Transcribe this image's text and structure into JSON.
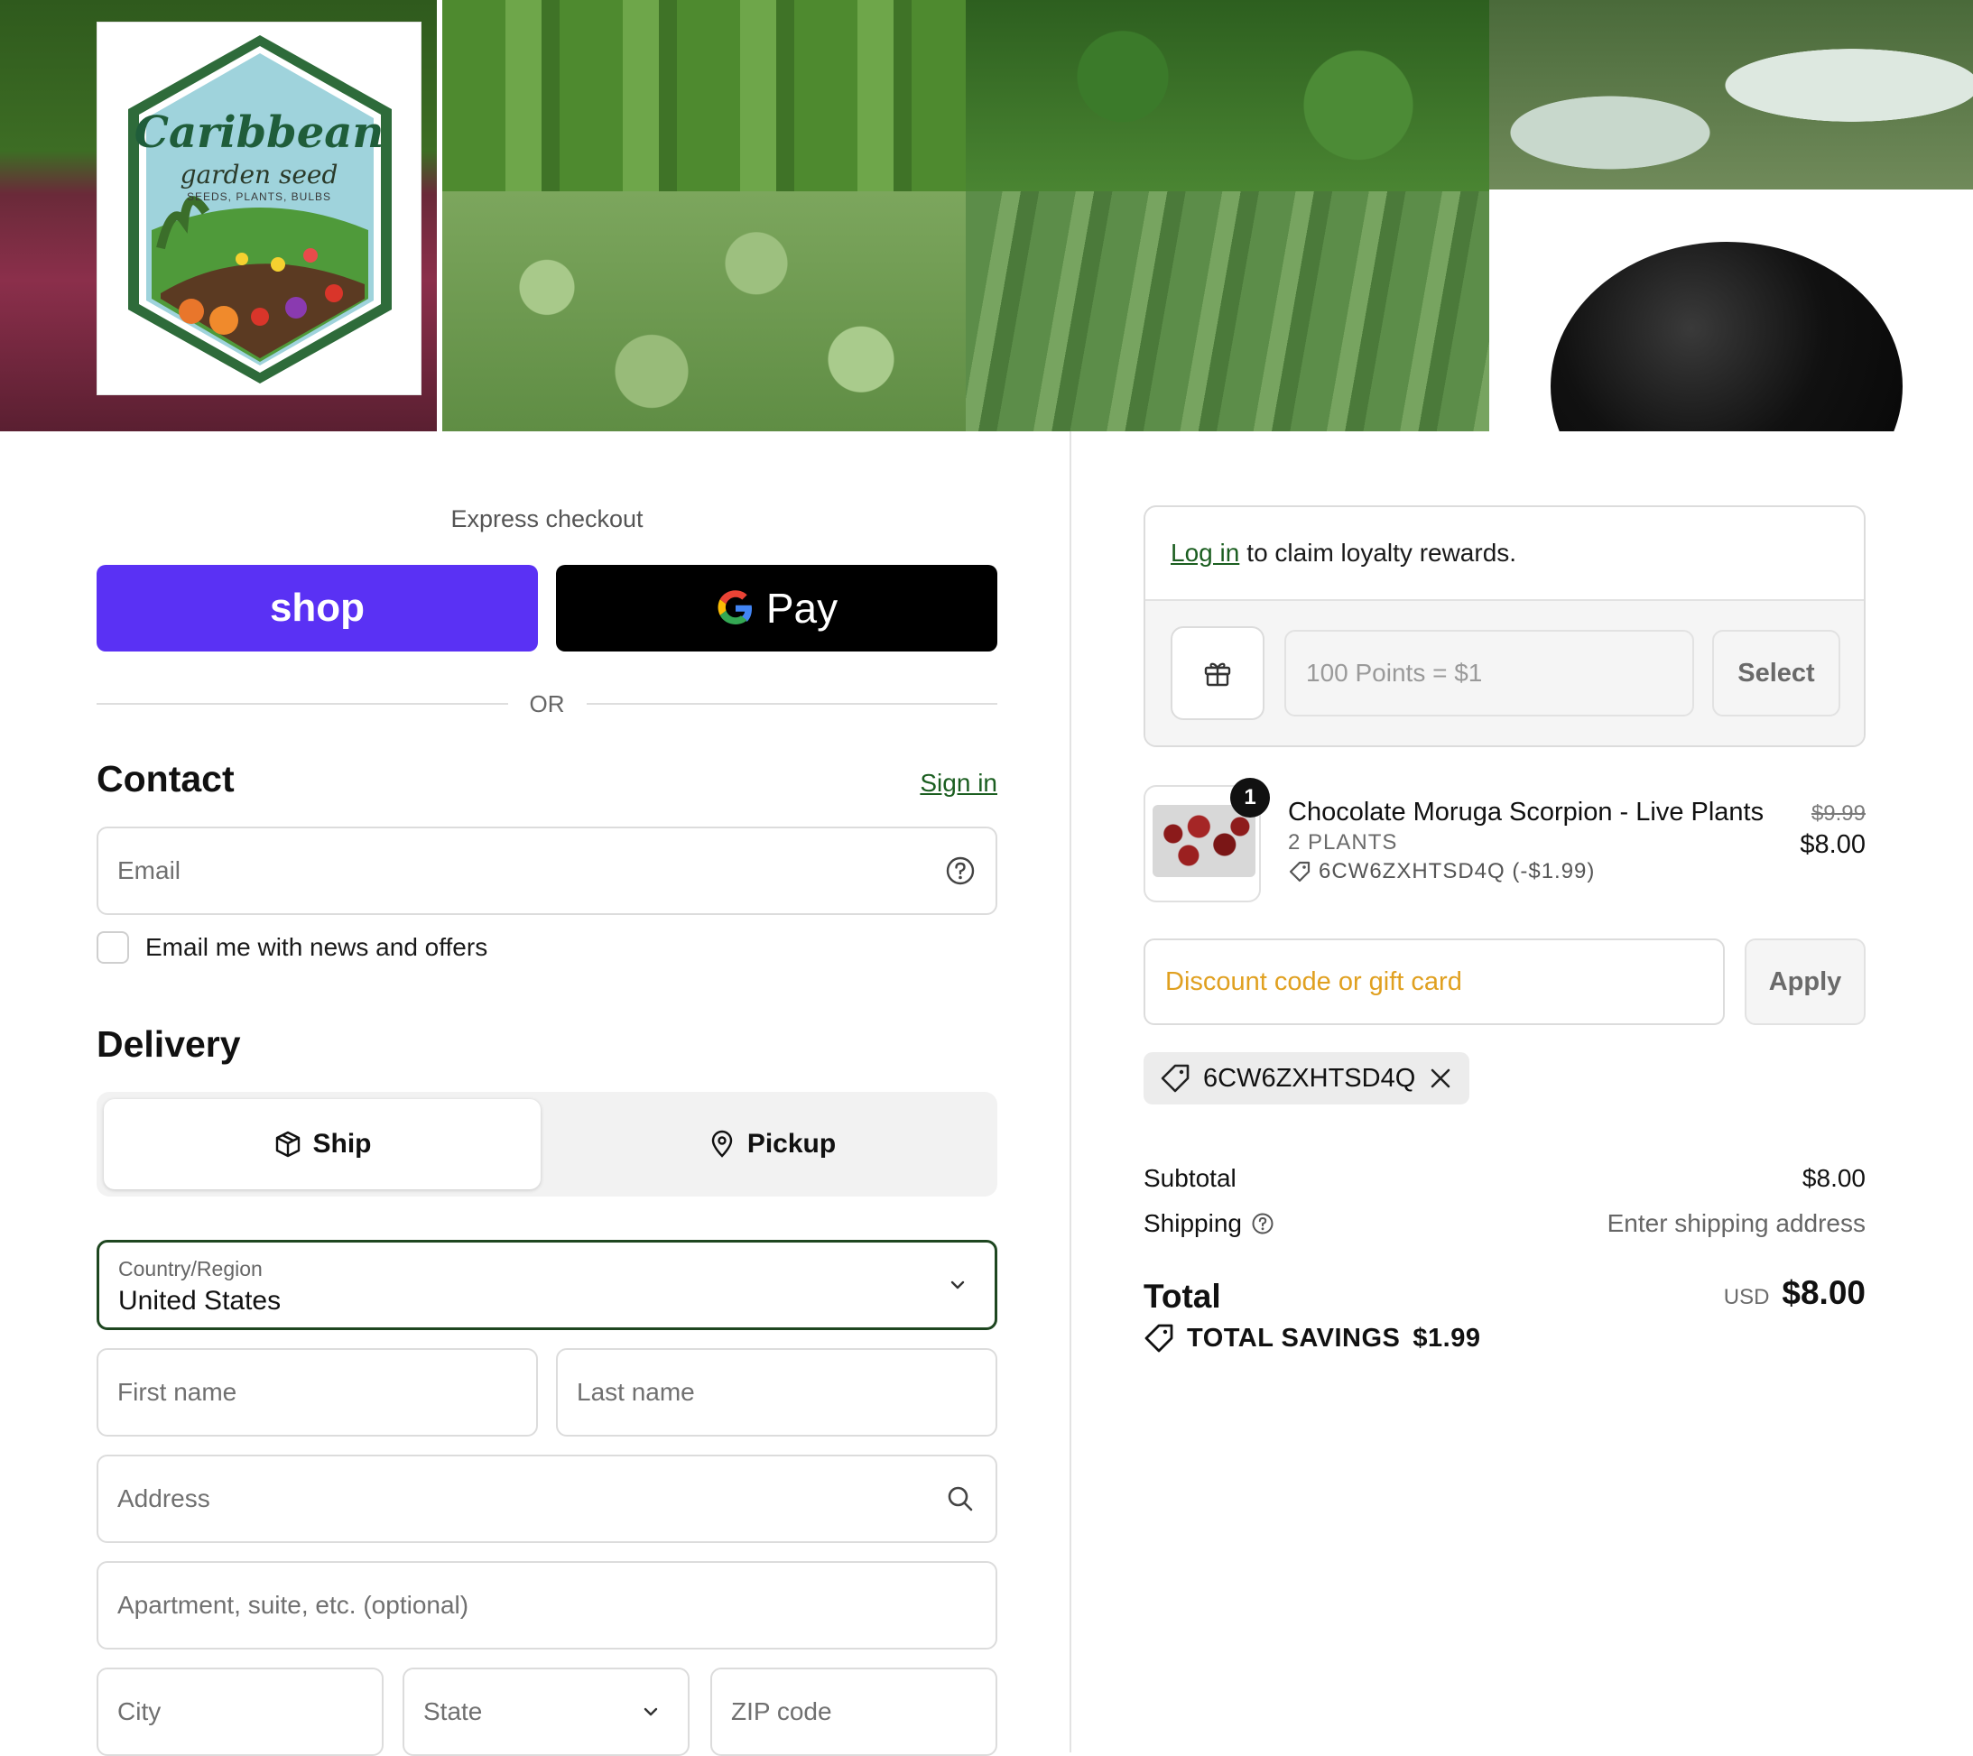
{
  "brand": {
    "name": "Caribbean",
    "subtitle": "garden seed",
    "tagline": "SEEDS, PLANTS, BULBS"
  },
  "express": {
    "label": "Express checkout",
    "shop_label": "shop",
    "gpay_label": "Pay",
    "or_label": "OR"
  },
  "contact": {
    "title": "Contact",
    "sign_in": "Sign in",
    "email_placeholder": "Email",
    "news_label": "Email me with news and offers",
    "news_checked": false
  },
  "delivery": {
    "title": "Delivery",
    "ship_label": "Ship",
    "pickup_label": "Pickup",
    "selected": "Ship",
    "country_label": "Country/Region",
    "country_value": "United States",
    "first_name_placeholder": "First name",
    "last_name_placeholder": "Last name",
    "address_placeholder": "Address",
    "apartment_placeholder": "Apartment, suite, etc. (optional)",
    "city_placeholder": "City",
    "state_placeholder": "State",
    "zip_placeholder": "ZIP code"
  },
  "loyalty": {
    "login_link": "Log in",
    "message": "to claim loyalty rewards.",
    "points_placeholder": "100 Points = $1",
    "select_label": "Select"
  },
  "cart": {
    "items": [
      {
        "name": "Chocolate Moruga Scorpion - Live Plants",
        "variant": "2 PLANTS",
        "discount": "6CW6ZXHTSD4Q (-$1.99)",
        "quantity": "1",
        "original_price": "$9.99",
        "price": "$8.00"
      }
    ],
    "discount_placeholder": "Discount code or gift card",
    "apply_label": "Apply",
    "applied_code": "6CW6ZXHTSD4Q"
  },
  "summary": {
    "subtotal_label": "Subtotal",
    "subtotal_value": "$8.00",
    "shipping_label": "Shipping",
    "shipping_value": "Enter shipping address",
    "total_label": "Total",
    "currency": "USD",
    "total_value": "$8.00",
    "savings_label": "TOTAL SAVINGS",
    "savings_value": "$1.99"
  },
  "colors": {
    "shop_purple": "#5a31f4",
    "accent_green": "#1b5e20",
    "focus_border": "#1e4620"
  }
}
